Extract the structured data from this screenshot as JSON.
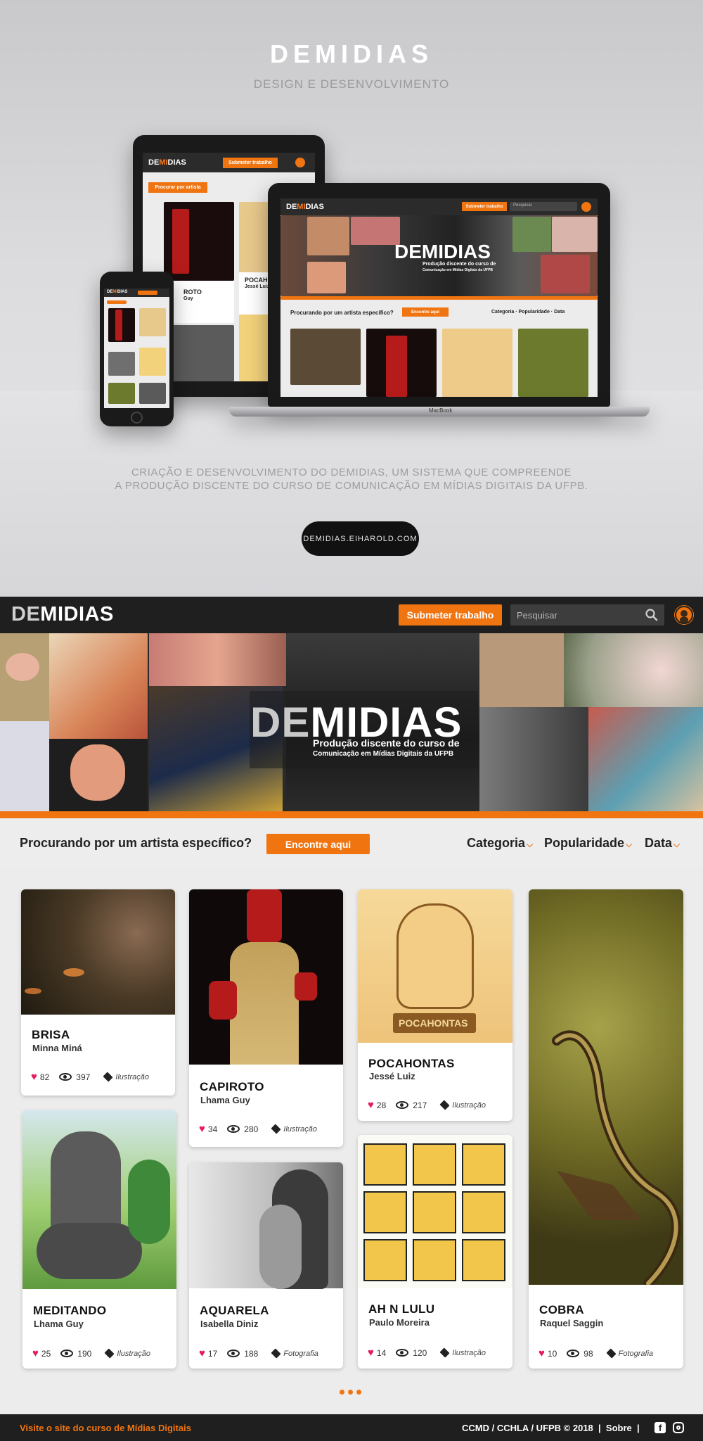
{
  "presentation": {
    "title": "DEMIDIAS",
    "subtitle": "DESIGN E DESENVOLVIMENTO",
    "description_line1": "CRIAÇÃO E DESENVOLVIMENTO DO DEMIDIAS, UM SISTEMA QUE COMPREENDE",
    "description_line2": "A PRODUÇÃO DISCENTE DO CURSO DE COMUNICAÇÃO EM MÍDIAS DIGITAIS DA UFPB.",
    "site_button": "DEMIDIAS.EIHAROLD.COM",
    "tablet": {
      "submit": "Submeter trabalho",
      "search_artist": "Procurar por artista",
      "card1_title": "ROTO",
      "card1_author": "Guy",
      "card2_title": "POCAHONT",
      "card2_author": "Jessé Luiz"
    },
    "laptop": {
      "submit": "Submeter trabalho",
      "search": "Pesquisar",
      "banner_line1": "Produção discente do curso de",
      "banner_line2": "Comunicação em Mídias Digitais da UFPB",
      "question": "Procurando por um artista específico?",
      "find": "Encontre aqui",
      "filters": "Categoria · Popularidade · Data",
      "brand": "MacBook"
    }
  },
  "header": {
    "logo_de": "DE",
    "logo_midias": "MIDIAS",
    "submit_label": "Submeter trabalho",
    "search_placeholder": "Pesquisar"
  },
  "banner": {
    "logo_de": "DE",
    "logo_midias": "MIDIAS",
    "line1": "Produção discente do curso de",
    "line2": "Comunicação em Mídias Digitais da UFPB"
  },
  "filters": {
    "question": "Procurando por um artista específico?",
    "find_label": "Encontre aqui",
    "category": "Categoria",
    "popularity": "Popularidade",
    "date": "Data"
  },
  "cards": [
    {
      "title": "BRISA",
      "author": "Minna Miná",
      "likes": "82",
      "views": "397",
      "category": "Ilustração"
    },
    {
      "title": "CAPIROTO",
      "author": "Lhama Guy",
      "likes": "34",
      "views": "280",
      "category": "Ilustração"
    },
    {
      "title": "POCAHONTAS",
      "author": "Jessé Luiz",
      "likes": "28",
      "views": "217",
      "category": "Ilustração"
    },
    {
      "title": "MEDITANDO",
      "author": "Lhama Guy",
      "likes": "25",
      "views": "190",
      "category": "Ilustração"
    },
    {
      "title": "AQUARELA",
      "author": "Isabella Diniz",
      "likes": "17",
      "views": "188",
      "category": "Fotografia"
    },
    {
      "title": "AH N LULU",
      "author": "Paulo Moreira",
      "likes": "14",
      "views": "120",
      "category": "Ilustração"
    },
    {
      "title": "COBRA",
      "author": "Raquel Saggin",
      "likes": "10",
      "views": "98",
      "category": "Fotografia"
    }
  ],
  "footer": {
    "left_link": "Visite o site do curso de Mídias Digitais",
    "credits": "CCMD / CCHLA / UFPB © 2018",
    "about": "Sobre"
  },
  "colors": {
    "accent": "#f07511",
    "dark": "#1f1f1f",
    "like": "#e41c5a"
  }
}
